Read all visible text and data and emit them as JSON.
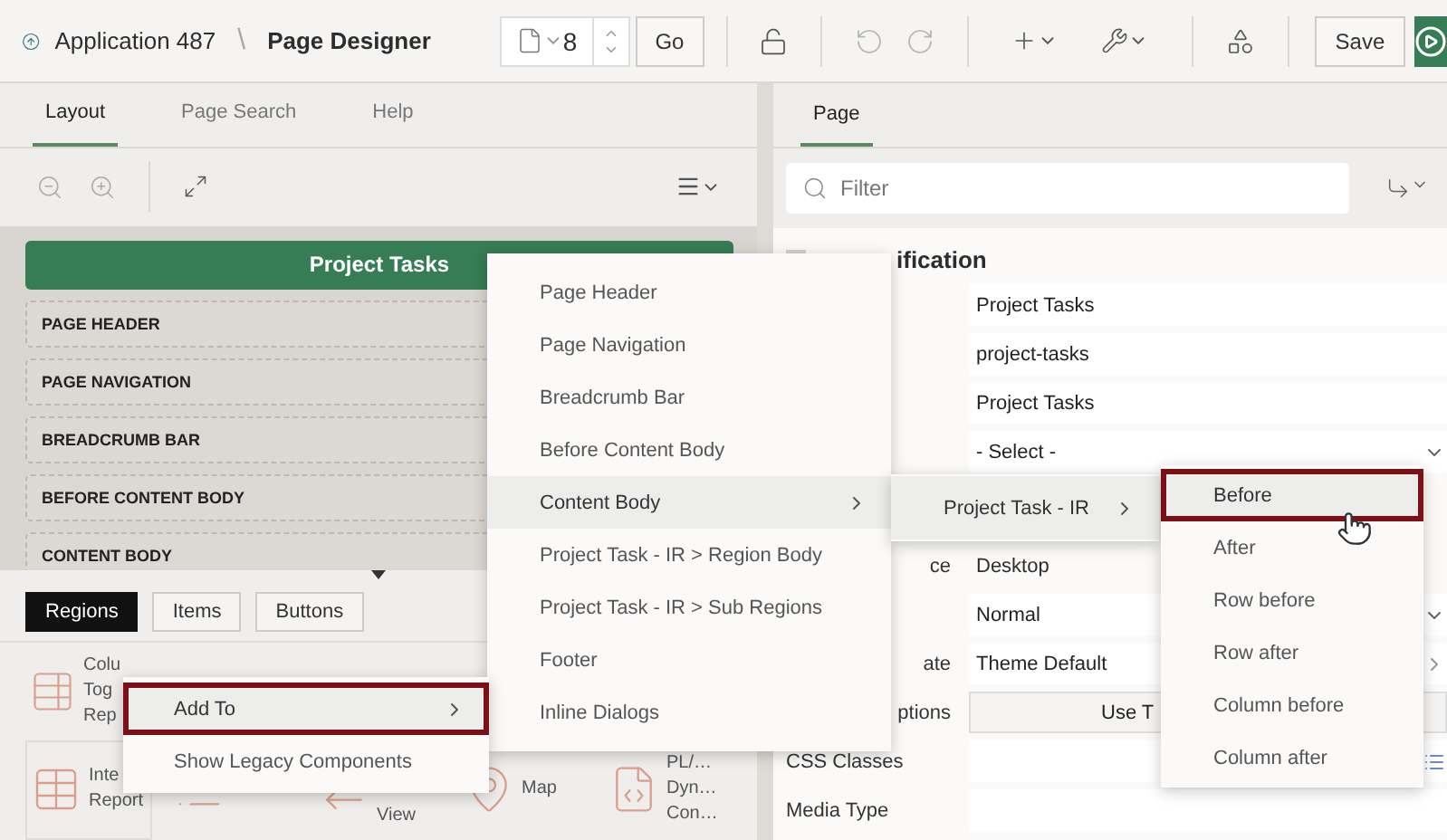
{
  "app_bar": {
    "application": "Application 487",
    "separator": "\\",
    "page_title": "Page Designer",
    "page_number": "8",
    "go_button": "Go",
    "save_button": "Save"
  },
  "left_panel": {
    "tabs": [
      {
        "label": "Layout",
        "selected": true
      },
      {
        "label": "Page Search",
        "selected": false
      },
      {
        "label": "Help",
        "selected": false
      }
    ],
    "page_title": "Project Tasks",
    "positions": [
      "PAGE HEADER",
      "PAGE NAVIGATION",
      "BREADCRUMB BAR",
      "BEFORE CONTENT BODY",
      "CONTENT BODY"
    ],
    "gallery_tabs": [
      {
        "label": "Regions",
        "selected": true
      },
      {
        "label": "Items",
        "selected": false
      },
      {
        "label": "Buttons",
        "selected": false
      }
    ],
    "gallery_top": [
      {
        "kind": "table-check",
        "lines": [
          "Colu",
          "Tog",
          "Rep"
        ]
      }
    ],
    "gallery_bottom": [
      {
        "kind": "grid-pointer",
        "lines": [
          "Inte",
          "Report"
        ]
      },
      {
        "kind": "list"
      },
      {
        "kind": "view",
        "lines": [
          "View"
        ]
      },
      {
        "kind": "map",
        "lines": [
          "Map"
        ]
      },
      {
        "kind": "plsql",
        "lines": [
          "PL/…",
          "Dyn…",
          "Con…"
        ]
      }
    ]
  },
  "right_panel": {
    "tabs": [
      {
        "label": "Page",
        "selected": true
      }
    ],
    "filter": {
      "placeholder": "Filter"
    },
    "section_title": "ification",
    "properties": [
      {
        "kind": "text",
        "value": "Project Tasks"
      },
      {
        "kind": "text",
        "value": "project-tasks"
      },
      {
        "kind": "text",
        "value": "Project Tasks"
      },
      {
        "kind": "select",
        "value": "- Select -"
      },
      {
        "kind": "static",
        "label": "ce",
        "value": "Desktop"
      },
      {
        "kind": "select",
        "value": "Normal"
      },
      {
        "kind": "link",
        "label": "ate",
        "value": "Theme Default"
      },
      {
        "kind": "button",
        "label": "ptions",
        "value": "Use T"
      },
      {
        "kind": "list",
        "label": "CSS Classes"
      },
      {
        "kind": "text",
        "label": "Media Type"
      }
    ]
  },
  "context_menu": [
    {
      "label": "Add To",
      "submenu": true,
      "selected": true
    },
    {
      "label": "Show Legacy Components",
      "submenu": false,
      "selected": false
    }
  ],
  "position_menu": [
    {
      "label": "Page Header",
      "submenu": false,
      "selected": false
    },
    {
      "label": "Page Navigation",
      "submenu": false,
      "selected": false
    },
    {
      "label": "Breadcrumb Bar",
      "submenu": false,
      "selected": false
    },
    {
      "label": "Before Content Body",
      "submenu": false,
      "selected": false
    },
    {
      "label": "Content Body",
      "submenu": true,
      "selected": true
    },
    {
      "label": "Project Task - IR > Region Body",
      "submenu": false,
      "selected": false
    },
    {
      "label": "Project Task - IR > Sub Regions",
      "submenu": false,
      "selected": false
    },
    {
      "label": "Footer",
      "submenu": false,
      "selected": false
    },
    {
      "label": "Inline Dialogs",
      "submenu": false,
      "selected": false
    }
  ],
  "region_menu": [
    {
      "label": "Project Task - IR",
      "submenu": true,
      "selected": true
    }
  ],
  "placement_menu": [
    {
      "label": "Before",
      "submenu": false,
      "selected": true,
      "outlined": true
    },
    {
      "label": "After",
      "submenu": false,
      "selected": false,
      "outlined": false
    },
    {
      "label": "Row before",
      "submenu": false,
      "selected": false,
      "outlined": false
    },
    {
      "label": "Row after",
      "submenu": false,
      "selected": false,
      "outlined": false
    },
    {
      "label": "Column before",
      "submenu": false,
      "selected": false,
      "outlined": false
    },
    {
      "label": "Column after",
      "submenu": false,
      "selected": false,
      "outlined": false
    }
  ]
}
